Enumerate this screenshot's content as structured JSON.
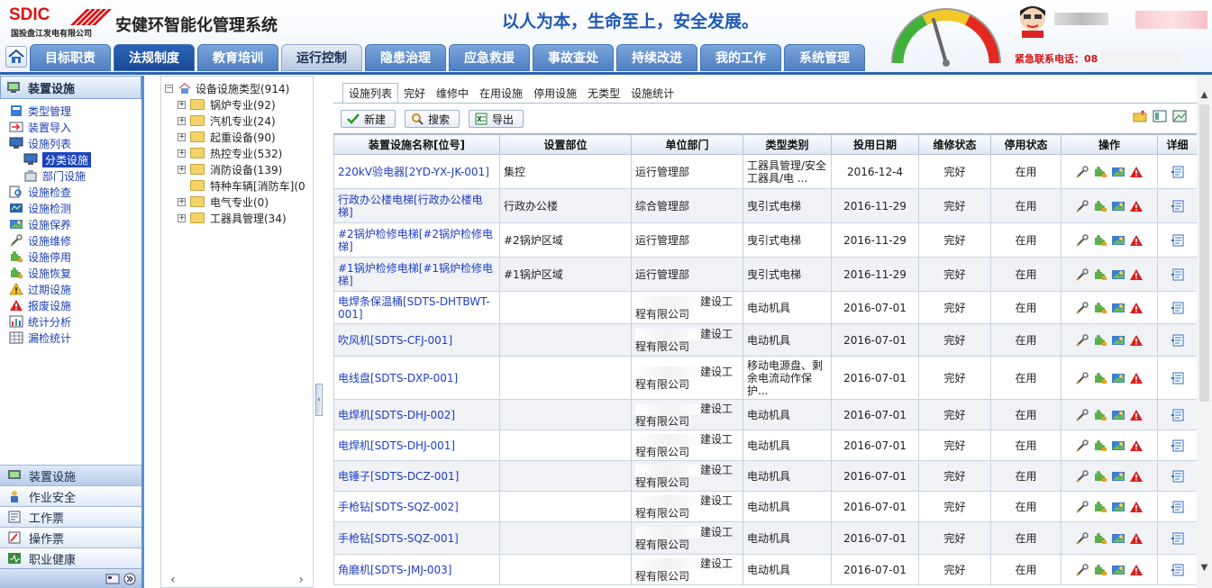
{
  "header": {
    "brand": "SDIC",
    "company": "国投盘江发电有限公司",
    "system_title": "安健环智能化管理系统",
    "slogan": "以人为本，生命至上，安全发展。",
    "emergency_label": "紧急联系电话：08"
  },
  "colors": {
    "accent": "#2d62b2",
    "nav_tab": "#5b8bcc",
    "nav_active": "#1f52a3",
    "link": "#1d3ec7",
    "danger": "#d51010"
  },
  "nav": {
    "tabs": [
      {
        "label": "目标职责",
        "state": "normal"
      },
      {
        "label": "法规制度",
        "state": "active"
      },
      {
        "label": "教育培训",
        "state": "normal"
      },
      {
        "label": "运行控制",
        "state": "dark"
      },
      {
        "label": "隐患治理",
        "state": "normal"
      },
      {
        "label": "应急救援",
        "state": "normal"
      },
      {
        "label": "事故查处",
        "state": "normal"
      },
      {
        "label": "持续改进",
        "state": "normal"
      },
      {
        "label": "我的工作",
        "state": "normal"
      },
      {
        "label": "系统管理",
        "state": "normal"
      }
    ]
  },
  "left": {
    "header": "装置设施",
    "items": [
      {
        "label": "类型管理",
        "icon": "book-icon"
      },
      {
        "label": "装置导入",
        "icon": "import-icon"
      },
      {
        "label": "设施列表",
        "icon": "monitor-icon"
      },
      {
        "label": "分类设施",
        "icon": "monitor-icon"
      },
      {
        "label": "部门设施",
        "icon": "department-icon"
      },
      {
        "label": "设施检查",
        "icon": "inspect-icon"
      },
      {
        "label": "设施检测",
        "icon": "detect-icon"
      },
      {
        "label": "设施保养",
        "icon": "maintain-icon"
      },
      {
        "label": "设施维修",
        "icon": "wrench-icon"
      },
      {
        "label": "设施停用",
        "icon": "puzzle-icon"
      },
      {
        "label": "设施恢复",
        "icon": "puzzle-icon"
      },
      {
        "label": "过期设施",
        "icon": "warning-icon"
      },
      {
        "label": "报废设施",
        "icon": "alert-icon"
      },
      {
        "label": "统计分析",
        "icon": "chart-icon"
      },
      {
        "label": "漏检统计",
        "icon": "grid-icon"
      }
    ],
    "bottom": [
      {
        "label": "装置设施",
        "icon": "device-icon"
      },
      {
        "label": "作业安全",
        "icon": "worker-icon"
      },
      {
        "label": "工作票",
        "icon": "ticket-icon"
      },
      {
        "label": "操作票",
        "icon": "operation-icon"
      },
      {
        "label": "职业健康",
        "icon": "health-icon"
      }
    ]
  },
  "tree": {
    "root": "设备设施类型(914)",
    "children": [
      {
        "label": "锅炉专业(92)",
        "expandable": true
      },
      {
        "label": "汽机专业(24)",
        "expandable": true
      },
      {
        "label": "起重设备(90)",
        "expandable": true
      },
      {
        "label": "热控专业(532)",
        "expandable": true
      },
      {
        "label": "消防设备(139)",
        "expandable": true
      },
      {
        "label": "特种车辆[消防车](0",
        "expandable": false
      },
      {
        "label": "电气专业(0)",
        "expandable": true
      },
      {
        "label": "工器具管理(34)",
        "expandable": true
      }
    ]
  },
  "main": {
    "tabs": [
      "设施列表",
      "完好",
      "维修中",
      "在用设施",
      "停用设施",
      "无类型",
      "设施统计"
    ],
    "active_tab": 0,
    "toolbar": {
      "new": "新建",
      "search": "搜索",
      "export": "导出"
    },
    "columns": [
      "装置设施名称[位号]",
      "设置部位",
      "单位部门",
      "类型类别",
      "投用日期",
      "维修状态",
      "停用状态",
      "操作",
      "详细"
    ],
    "rows": [
      {
        "name": "220kV验电器[2YD-YX-JK-001]",
        "location": "集控",
        "dept": "运行管理部",
        "dept_masked": false,
        "category": "工器具管理/安全工器具/电 ...",
        "date": "2016-12-4",
        "repair": "完好",
        "use": "在用"
      },
      {
        "name": "行政办公楼电梯[行政办公楼电梯]",
        "location": "行政办公楼",
        "dept": "综合管理部",
        "dept_masked": false,
        "category": "曳引式电梯",
        "date": "2016-11-29",
        "repair": "完好",
        "use": "在用"
      },
      {
        "name": "#2锅炉检修电梯[#2锅炉检修电梯]",
        "location": "#2锅炉区域",
        "dept": "运行管理部",
        "dept_masked": false,
        "category": "曳引式电梯",
        "date": "2016-11-29",
        "repair": "完好",
        "use": "在用"
      },
      {
        "name": "#1锅炉检修电梯[#1锅炉检修电梯]",
        "location": "#1锅炉区域",
        "dept": "运行管理部",
        "dept_masked": false,
        "category": "曳引式电梯",
        "date": "2016-11-29",
        "repair": "完好",
        "use": "在用"
      },
      {
        "name": "电焊条保温桶[SDTS-DHTBWT-001]",
        "location": "",
        "dept": "建设工程有限公司",
        "dept_masked": true,
        "category": "电动机具",
        "date": "2016-07-01",
        "repair": "完好",
        "use": "在用"
      },
      {
        "name": "吹风机[SDTS-CFJ-001]",
        "location": "",
        "dept": "建设工程有限公司",
        "dept_masked": true,
        "category": "电动机具",
        "date": "2016-07-01",
        "repair": "完好",
        "use": "在用"
      },
      {
        "name": "电线盘[SDTS-DXP-001]",
        "location": "",
        "dept": "建设工程有限公司",
        "dept_masked": true,
        "category": "移动电源盘、剩余电流动作保护...",
        "date": "2016-07-01",
        "repair": "完好",
        "use": "在用"
      },
      {
        "name": "电焊机[SDTS-DHJ-002]",
        "location": "",
        "dept": "建设工程有限公司",
        "dept_masked": true,
        "category": "电动机具",
        "date": "2016-07-01",
        "repair": "完好",
        "use": "在用"
      },
      {
        "name": "电焊机[SDTS-DHJ-001]",
        "location": "",
        "dept": "建设工程有限公司",
        "dept_masked": true,
        "category": "电动机具",
        "date": "2016-07-01",
        "repair": "完好",
        "use": "在用"
      },
      {
        "name": "电锤子[SDTS-DCZ-001]",
        "location": "",
        "dept": "建设工程有限公司",
        "dept_masked": true,
        "category": "电动机具",
        "date": "2016-07-01",
        "repair": "完好",
        "use": "在用"
      },
      {
        "name": "手枪钻[SDTS-SQZ-002]",
        "location": "",
        "dept": "建设工程有限公司",
        "dept_masked": true,
        "category": "电动机具",
        "date": "2016-07-01",
        "repair": "完好",
        "use": "在用"
      },
      {
        "name": "手枪钻[SDTS-SQZ-001]",
        "location": "",
        "dept": "建设工程有限公司",
        "dept_masked": true,
        "category": "电动机具",
        "date": "2016-07-01",
        "repair": "完好",
        "use": "在用"
      },
      {
        "name": "角磨机[SDTS-JMJ-003]",
        "location": "",
        "dept": "建设工程有限公司",
        "dept_masked": true,
        "category": "电动机具",
        "date": "2016-07-01",
        "repair": "完好",
        "use": "在用"
      }
    ],
    "row_actions": [
      "wrench-icon",
      "puzzle-icon",
      "maintain-icon",
      "alert-icon"
    ]
  }
}
